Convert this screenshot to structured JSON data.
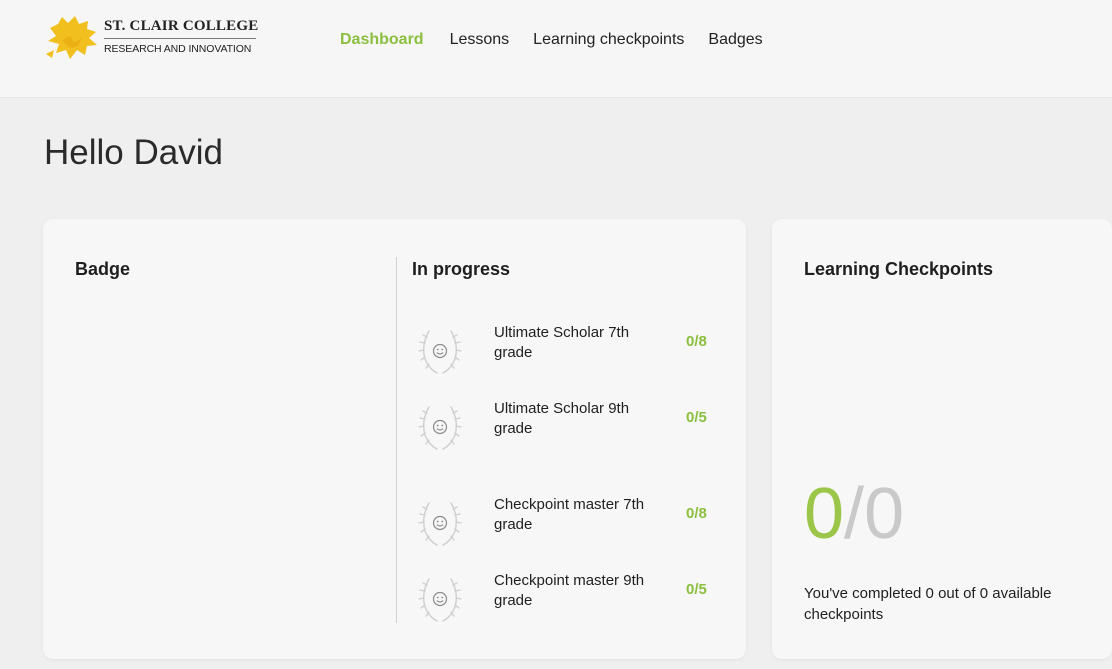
{
  "brand": {
    "line1": "ST. CLAIR COLLEGE",
    "line2": "RESEARCH AND INNOVATION",
    "colors": {
      "mark": "#f2c01e",
      "accent": "#8cbf3f"
    }
  },
  "nav": {
    "items": [
      {
        "label": "Dashboard",
        "active": true
      },
      {
        "label": "Lessons",
        "active": false
      },
      {
        "label": "Learning checkpoints",
        "active": false
      },
      {
        "label": "Badges",
        "active": false
      }
    ]
  },
  "greeting": "Hello David",
  "badge_card": {
    "badge_title": "Badge",
    "in_progress_title": "In progress",
    "items": [
      {
        "name": "Ultimate Scholar 7th grade",
        "count": "0/8",
        "icon": "smiley-wreath-icon"
      },
      {
        "name": "Ultimate Scholar 9th grade",
        "count": "0/5",
        "icon": "smiley-wreath-icon"
      },
      {
        "name": "Checkpoint master 7th grade",
        "count": "0/8",
        "icon": "smiley-wreath-icon"
      },
      {
        "name": "Checkpoint master 9th grade",
        "count": "0/5",
        "icon": "smiley-wreath-icon"
      }
    ]
  },
  "checkpoints_card": {
    "title": "Learning Checkpoints",
    "completed": "0",
    "separator": "/",
    "total": "0",
    "description": "You've completed 0 out of 0 available checkpoints"
  }
}
